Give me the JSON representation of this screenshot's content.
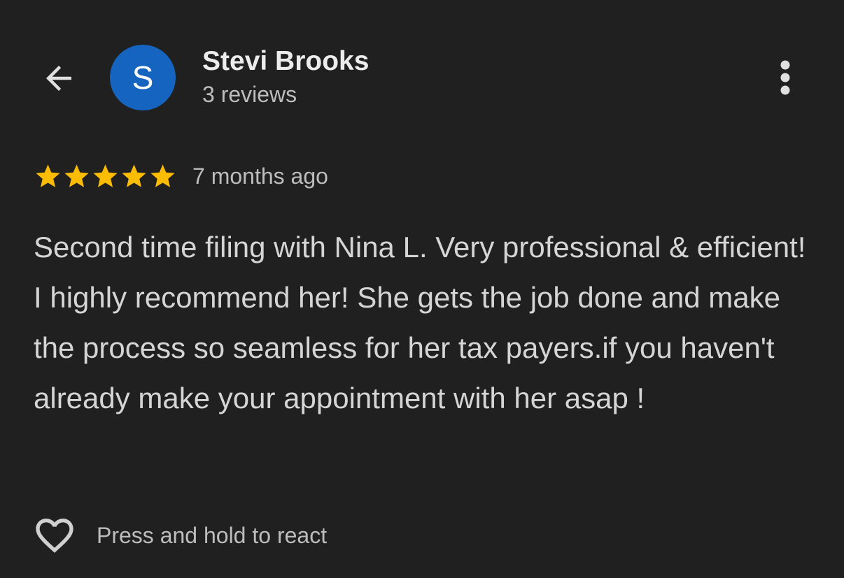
{
  "header": {
    "back_icon": "arrow-left-icon",
    "more_icon": "more-vert-icon"
  },
  "reviewer": {
    "avatar_letter": "S",
    "avatar_color": "#1565c0",
    "name": "Stevi Brooks",
    "review_count": "3 reviews"
  },
  "review": {
    "rating": 5,
    "max_rating": 5,
    "star_color": "#fbbc04",
    "date": "7 months ago",
    "text": "Second time filing with Nina L. Very professional & efficient! I highly recommend her! She gets the job done and make the process so seamless for her tax payers.if you haven't already make your appointment with her asap !"
  },
  "reaction": {
    "icon": "heart-outline-icon",
    "label": "Press and hold to react"
  }
}
